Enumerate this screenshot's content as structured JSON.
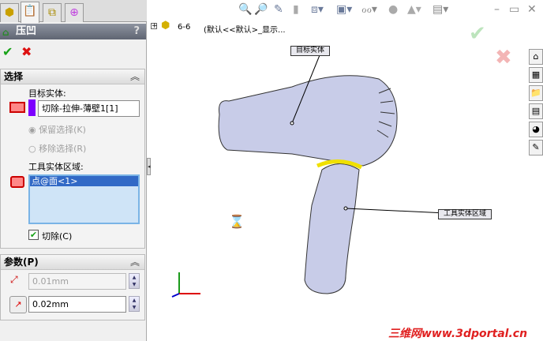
{
  "panel": {
    "title": "压凹",
    "help": "?",
    "tabs": [
      {
        "name": "feature-manager"
      },
      {
        "name": "property-manager"
      },
      {
        "name": "configuration-manager"
      },
      {
        "name": "dimxpert-manager"
      }
    ],
    "selection": {
      "header": "选择",
      "target_label": "目标实体:",
      "target_value": "切除-拉伸-薄壁1[1]",
      "keep": "保留选择(K)",
      "remove": "移除选择(R)",
      "tool_label": "工具实体区域:",
      "tool_items": [
        "点@面<1>"
      ],
      "cut_label": "切除(C)",
      "cut_checked": true
    },
    "params": {
      "header": "参数(P)",
      "thickness": "0.01mm",
      "clearance": "0.02mm"
    }
  },
  "view": {
    "tree_label": "6-6",
    "tree_config": "(默认<<默认>_显示...",
    "callout_target": "目标实体",
    "callout_tool": "工具实体区域",
    "watermark": "三维网www.3dportal.cn",
    "accent": "#7d00ff"
  }
}
